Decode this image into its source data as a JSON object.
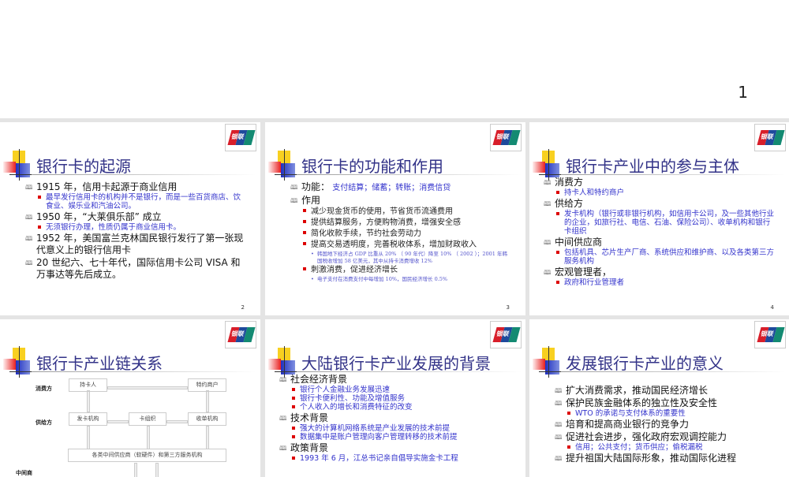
{
  "top_page_number": "1",
  "logo_text": "银联",
  "slides": [
    {
      "title": "银行卡的起源",
      "number": "2",
      "items": [
        {
          "level": 1,
          "text": "1915 年，信用卡起源于商业信用"
        },
        {
          "level": 2,
          "text": "最早发行信用卡的机构并不是银行，而是一些百货商店、饮食业、娱乐业和汽油公司。"
        },
        {
          "level": 1,
          "text": "1950 年，“大莱俱乐部” 成立"
        },
        {
          "level": 2,
          "text": "无须银行办理，性质仍属于商业信用卡。"
        },
        {
          "level": 1,
          "text": "1952 年，美国富兰克林国民银行发行了第一张现代意义上的银行信用卡"
        },
        {
          "level": 1,
          "text": "20 世纪六、七十年代，国际信用卡公司 VISA 和万事达等先后成立。"
        }
      ]
    },
    {
      "title": "银行卡的功能和作用",
      "number": "3",
      "items": [
        {
          "level": 1,
          "text": "功能：",
          "blue": "支付结算；储蓄；转账；消费信贷"
        },
        {
          "level": 1,
          "text": "作用"
        },
        {
          "level": 2,
          "text": "减少现金货币的使用，节省货币流通费用",
          "dark": true
        },
        {
          "level": 2,
          "text": "提供结算服务，方便购物消费，增强安全感",
          "dark": true
        },
        {
          "level": 2,
          "text": "简化收款手续，节约社会劳动力",
          "dark": true
        },
        {
          "level": 2,
          "text": "提高交易透明度，完善税收体系，增加财政收入",
          "dark": true
        },
        {
          "level": 3,
          "text": "韩国地下经济占 GDP 比重从 20% （ 90 年代）降至 10% （ 2002 ）；2001 年韩国税收增加 58 亿美元，其中从持卡消费增收 12%"
        },
        {
          "level": 2,
          "text": "刺激消费，促进经济增长",
          "dark": true
        },
        {
          "level": 3,
          "text": "电子支付在消费支付中每增加 10%，国民经济增长 0.5%"
        }
      ]
    },
    {
      "title": "银行卡产业中的参与主体",
      "number": "4",
      "items": [
        {
          "level": 1,
          "text": "消费方"
        },
        {
          "level": 2,
          "text": "持卡人和特约商户"
        },
        {
          "level": 1,
          "text": "供给方"
        },
        {
          "level": 2,
          "text": "发卡机构（银行或非银行机构，如信用卡公司，及一些其他行业的企业，如旅行社、电信、石油、保险公司）、收单机构和银行卡组织"
        },
        {
          "level": 1,
          "text": "中间供应商"
        },
        {
          "level": 2,
          "text": "包括机具、芯片生产厂商、系统供应和维护商、以及各类第三方服务机构"
        },
        {
          "level": 1,
          "text": "宏观管理者，"
        },
        {
          "level": 2,
          "text": "政府和行业管理者"
        }
      ]
    },
    {
      "title": "银行卡产业链关系",
      "diagram": {
        "labels": [
          "消费方",
          "供给方",
          "中间商"
        ],
        "boxes": [
          "持卡人",
          "特约商户",
          "发卡机构",
          "卡组织",
          "收单机构",
          "各类中间供应商（软硬件）和第三方服务机构"
        ]
      }
    },
    {
      "title": "大陆银行卡产业发展的背景",
      "items": [
        {
          "level": 1,
          "text": "社会经济背景"
        },
        {
          "level": 2,
          "text": "银行个人金融业务发展迅速"
        },
        {
          "level": 2,
          "text": "银行卡便利性、功能及增值服务"
        },
        {
          "level": 2,
          "text": "个人收入的增长和消费特征的改变"
        },
        {
          "level": 1,
          "text": "技术背景"
        },
        {
          "level": 2,
          "text": "强大的计算机网络系统是产业发展的技术前提"
        },
        {
          "level": 2,
          "text": "数据集中是账户管理向客户管理转移的技术前提"
        },
        {
          "level": 1,
          "text": "政策背景"
        },
        {
          "level": 2,
          "text": "1993 年 6 月，江总书记亲自倡导实施金卡工程"
        }
      ]
    },
    {
      "title": "发展银行卡产业的意义",
      "items": [
        {
          "level": 1,
          "text": "扩大消费需求，推动国民经济增长"
        },
        {
          "level": 1,
          "text": "保护民族金融体系的独立性及安全性"
        },
        {
          "level": 2,
          "text": "WTO 的承诺与支付体系的重要性"
        },
        {
          "level": 1,
          "text": "培育和提高商业银行的竞争力"
        },
        {
          "level": 1,
          "text": "促进社会进步，强化政府宏观调控能力"
        },
        {
          "level": 2,
          "text": "信用；公共支付；货币供应；偷税漏税"
        },
        {
          "level": 1,
          "text": "提升祖国大陆国际形象，推动国际化进程"
        }
      ]
    }
  ]
}
